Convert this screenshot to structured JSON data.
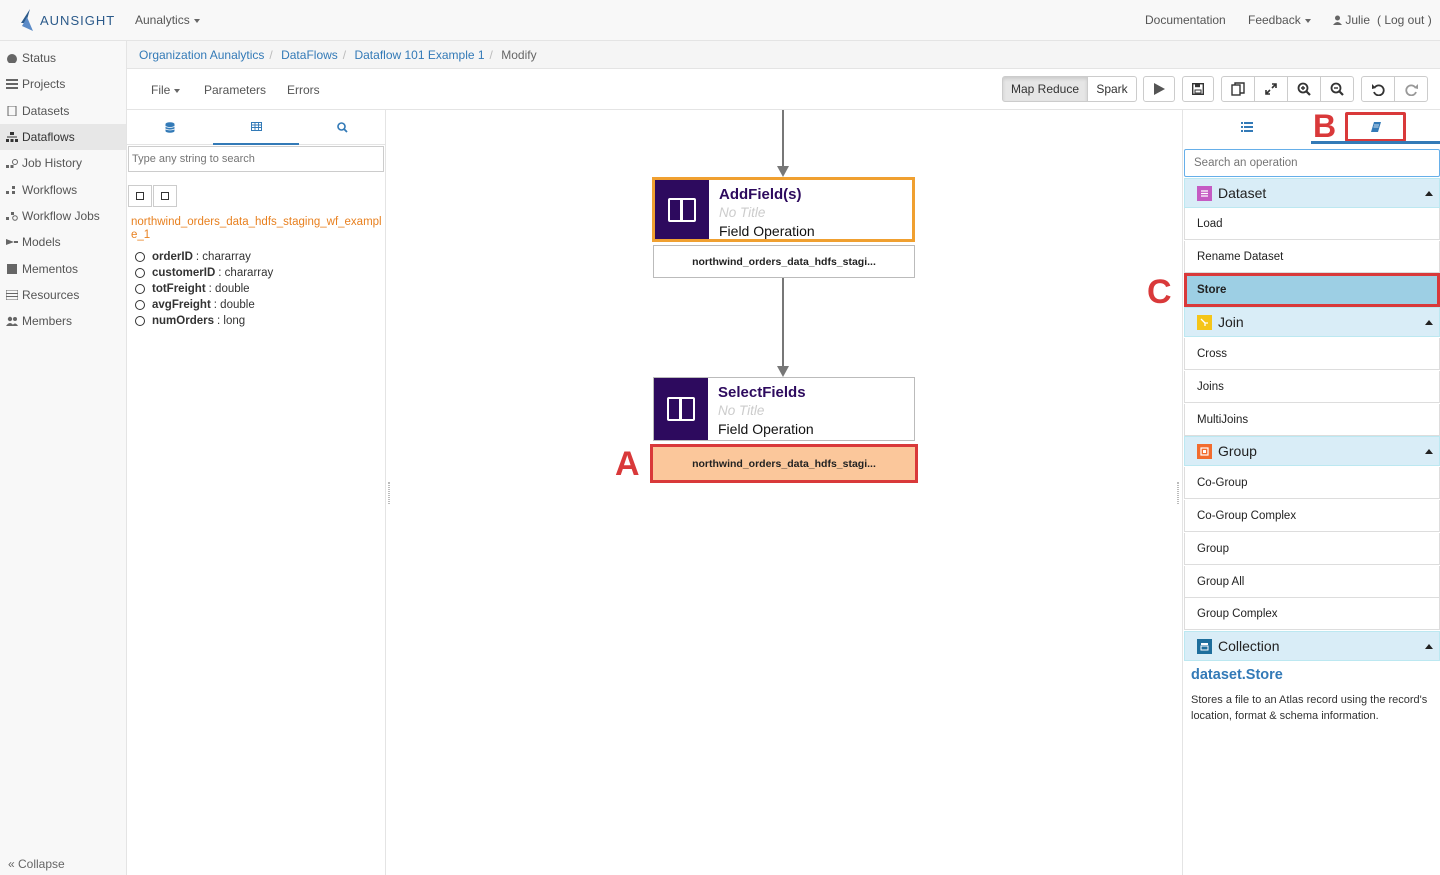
{
  "app": {
    "brand": "AUNSIGHT",
    "menu": "Aunalytics"
  },
  "topnav": {
    "documentation": "Documentation",
    "feedback": "Feedback",
    "user": "Julie",
    "logout": "( Log out )"
  },
  "sidebar": {
    "items": [
      {
        "label": "Status",
        "icon": "dashboard-icon"
      },
      {
        "label": "Projects",
        "icon": "list-icon"
      },
      {
        "label": "Datasets",
        "icon": "file-icon"
      },
      {
        "label": "Dataflows",
        "icon": "sitemap-icon"
      },
      {
        "label": "Job History",
        "icon": "history-icon"
      },
      {
        "label": "Workflows",
        "icon": "workflow-icon"
      },
      {
        "label": "Workflow Jobs",
        "icon": "workflow-jobs-icon"
      },
      {
        "label": "Models",
        "icon": "model-icon"
      },
      {
        "label": "Mementos",
        "icon": "memento-icon"
      },
      {
        "label": "Resources",
        "icon": "resources-icon"
      },
      {
        "label": "Members",
        "icon": "users-icon"
      }
    ],
    "active": "Dataflows",
    "collapse": "« Collapse"
  },
  "breadcrumb": {
    "items": [
      "Organization Aunalytics",
      "DataFlows",
      "Dataflow 101 Example 1"
    ],
    "current": "Modify"
  },
  "toolbar": {
    "file": "File",
    "parameters": "Parameters",
    "errors": "Errors",
    "map_reduce": "Map Reduce",
    "spark": "Spark",
    "active_engine": "Map Reduce"
  },
  "left_panel": {
    "search_placeholder": "Type any string to search",
    "dataset_name": "northwind_orders_data_hdfs_staging_wf_example_1",
    "fields": [
      {
        "name": "orderID",
        "type": ": chararray"
      },
      {
        "name": "customerID",
        "type": ": chararray"
      },
      {
        "name": "totFreight",
        "type": ": double"
      },
      {
        "name": "avgFreight",
        "type": ": double"
      },
      {
        "name": "numOrders",
        "type": ": long"
      }
    ]
  },
  "canvas": {
    "nodes": [
      {
        "name": "AddField(s)",
        "subtitle": "No Title",
        "type": "Field Operation",
        "output": "northwind_orders_data_hdfs_stagi..."
      },
      {
        "name": "SelectFields",
        "subtitle": "No Title",
        "type": "Field Operation",
        "output": "northwind_orders_data_hdfs_stagi..."
      }
    ]
  },
  "annotations": {
    "a": "A",
    "b": "B",
    "c": "C"
  },
  "right_panel": {
    "search_placeholder": "Search an operation",
    "categories": [
      {
        "name": "Dataset",
        "color": "#c55bc3",
        "ops": [
          "Load",
          "Rename Dataset",
          "Store"
        ]
      },
      {
        "name": "Join",
        "color": "#f5c518",
        "ops": [
          "Cross",
          "Joins",
          "MultiJoins"
        ]
      },
      {
        "name": "Group",
        "color": "#f26c2e",
        "ops": [
          "Co-Group",
          "Co-Group Complex",
          "Group",
          "Group All",
          "Group Complex"
        ]
      },
      {
        "name": "Collection",
        "color": "#1e6e9c",
        "ops": []
      }
    ],
    "selected_op": "Store",
    "doc_title": "dataset.Store",
    "doc_text": "Stores a file to an Atlas record using the record's location, format & schema information."
  },
  "colors": {
    "accent": "#337ab7",
    "node_icon_bg": "#2d0a5e",
    "highlight_red": "#d9393a",
    "orange_border": "#f0a030"
  }
}
